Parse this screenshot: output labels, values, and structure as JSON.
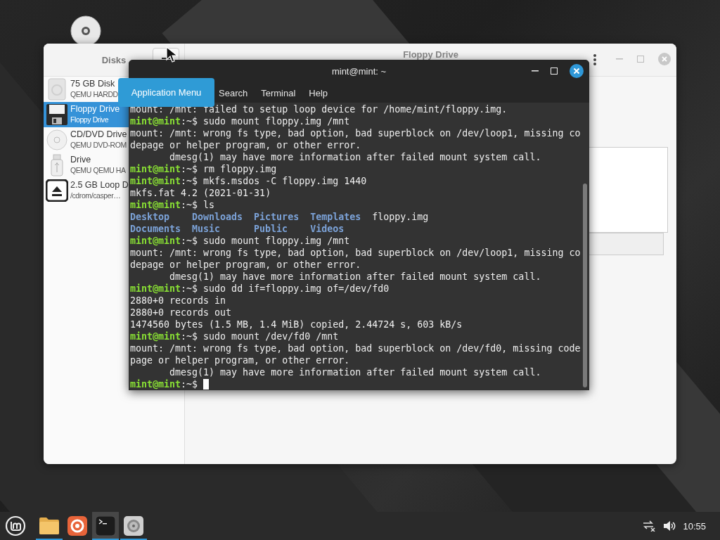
{
  "disks_window": {
    "sidebar_title": "Disks",
    "title": "Floppy Drive",
    "devices": [
      {
        "kind": "hdd",
        "name": "75 GB Disk",
        "detail": "QEMU HARDD",
        "selected": false
      },
      {
        "kind": "floppy",
        "name": "Floppy Drive",
        "detail": "Floppy Drive",
        "selected": true
      },
      {
        "kind": "optical",
        "name": "CD/DVD Drive",
        "detail": "QEMU DVD-ROM",
        "selected": false
      },
      {
        "kind": "usb",
        "name": "Drive",
        "detail": "QEMU QEMU HA",
        "selected": false
      },
      {
        "kind": "loop",
        "name": "2.5 GB Loop D",
        "detail": "/cdrom/casper…",
        "selected": false
      }
    ]
  },
  "terminal": {
    "title": "mint@mint: ~",
    "menu": [
      "Search",
      "Terminal",
      "Help"
    ],
    "lines": [
      {
        "kind": "output",
        "text": "mount: /mnt: failed to setup loop device for /home/mint/floppy.img."
      },
      {
        "kind": "prompt",
        "user": "mint@mint",
        "path": ":~$",
        "command": "sudo mount floppy.img /mnt"
      },
      {
        "kind": "output",
        "text": "mount: /mnt: wrong fs type, bad option, bad superblock on /dev/loop1, missing co"
      },
      {
        "kind": "output",
        "text": "depage or helper program, or other error."
      },
      {
        "kind": "output",
        "text": "       dmesg(1) may have more information after failed mount system call."
      },
      {
        "kind": "prompt",
        "user": "mint@mint",
        "path": ":~$",
        "command": "rm floppy.img"
      },
      {
        "kind": "prompt",
        "user": "mint@mint",
        "path": ":~$",
        "command": "mkfs.msdos -C floppy.img 1440"
      },
      {
        "kind": "output",
        "text": "mkfs.fat 4.2 (2021-01-31)"
      },
      {
        "kind": "prompt",
        "user": "mint@mint",
        "path": ":~$",
        "command": "ls"
      },
      {
        "kind": "listing",
        "entries": [
          {
            "name": "Desktop",
            "directory": true
          },
          {
            "name": "Downloads",
            "directory": true
          },
          {
            "name": "Pictures",
            "directory": true
          },
          {
            "name": "Templates",
            "directory": true
          },
          {
            "name": "floppy.img",
            "directory": false
          }
        ]
      },
      {
        "kind": "listing",
        "entries": [
          {
            "name": "Documents",
            "directory": true
          },
          {
            "name": "Music",
            "directory": true
          },
          {
            "name": "Public",
            "directory": true
          },
          {
            "name": "Videos",
            "directory": true
          }
        ]
      },
      {
        "kind": "prompt",
        "user": "mint@mint",
        "path": ":~$",
        "command": "sudo mount floppy.img /mnt"
      },
      {
        "kind": "output",
        "text": "mount: /mnt: wrong fs type, bad option, bad superblock on /dev/loop1, missing co"
      },
      {
        "kind": "output",
        "text": "depage or helper program, or other error."
      },
      {
        "kind": "output",
        "text": "       dmesg(1) may have more information after failed mount system call."
      },
      {
        "kind": "prompt",
        "user": "mint@mint",
        "path": ":~$",
        "command": "sudo dd if=floppy.img of=/dev/fd0"
      },
      {
        "kind": "output",
        "text": "2880+0 records in"
      },
      {
        "kind": "output",
        "text": "2880+0 records out"
      },
      {
        "kind": "output",
        "text": "1474560 bytes (1.5 MB, 1.4 MiB) copied, 2.44724 s, 603 kB/s"
      },
      {
        "kind": "prompt",
        "user": "mint@mint",
        "path": ":~$",
        "command": "sudo mount /dev/fd0 /mnt"
      },
      {
        "kind": "output",
        "text": "mount: /mnt: wrong fs type, bad option, bad superblock on /dev/fd0, missing code"
      },
      {
        "kind": "output",
        "text": "page or helper program, or other error."
      },
      {
        "kind": "output",
        "text": "       dmesg(1) may have more information after failed mount system call."
      },
      {
        "kind": "prompt",
        "user": "mint@mint",
        "path": ":~$",
        "cursor": true
      }
    ]
  },
  "tooltip": "Application Menu",
  "taskbar": {
    "apps": [
      {
        "kind": "files",
        "running": true,
        "active": false
      },
      {
        "kind": "browser",
        "running": false,
        "active": false
      },
      {
        "kind": "terminal",
        "running": true,
        "active": true
      },
      {
        "kind": "disks",
        "running": true,
        "active": false
      }
    ],
    "clock": "10:55"
  }
}
